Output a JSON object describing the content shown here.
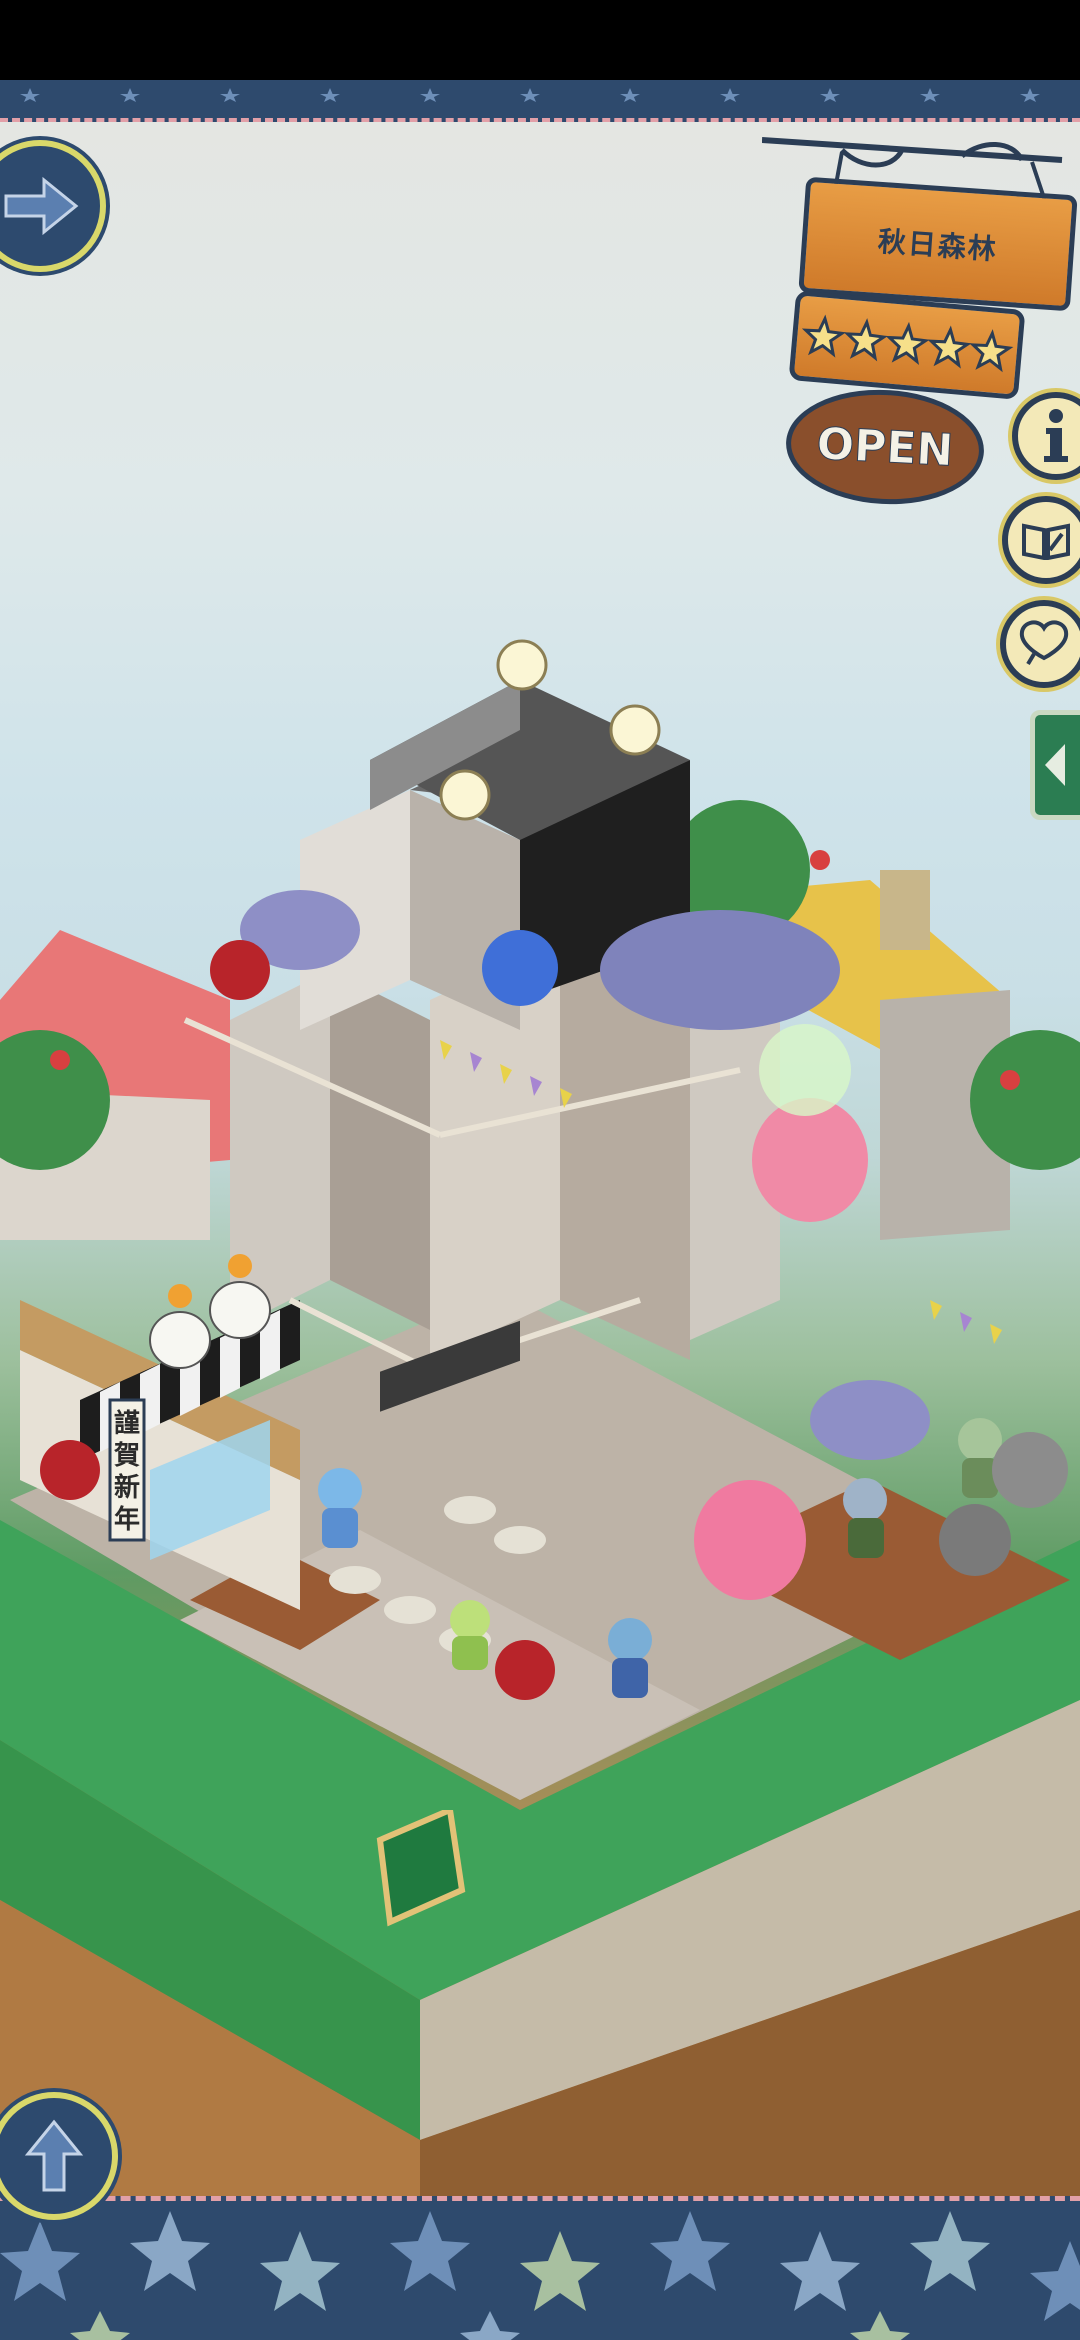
{
  "shop": {
    "name": "秋日森林",
    "rating_stars": 5,
    "status_label": "OPEN"
  },
  "buttons": {
    "next": "arrow-right-icon",
    "up": "arrow-up-icon",
    "info": "info-icon",
    "book": "book-icon",
    "heart": "heart-icon",
    "collapse": "chevron-left-icon"
  },
  "decor": {
    "new_year_banner": "謹賀新年"
  },
  "colors": {
    "border_navy": "#2e4a6d",
    "accent_yellow": "#d9d86a",
    "sign_orange": "#e89d45",
    "tab_green": "#2b7d52"
  }
}
